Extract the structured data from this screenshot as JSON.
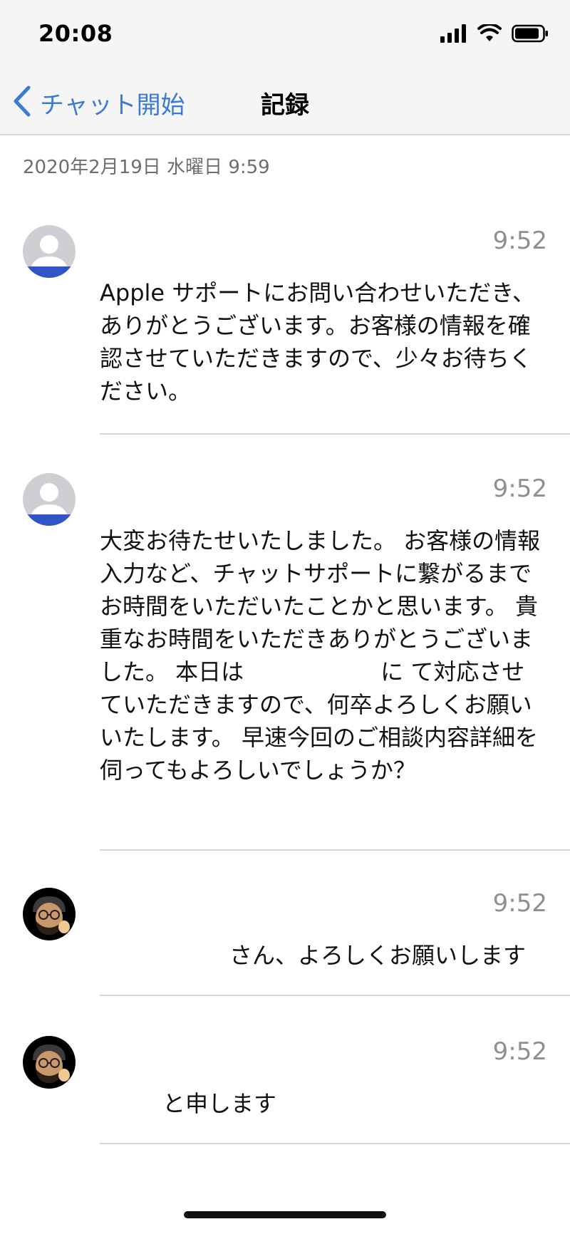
{
  "status_bar": {
    "time": "20:08",
    "icons": [
      "signal-icon",
      "wifi-icon",
      "battery-icon"
    ]
  },
  "nav": {
    "back_label": "チャット開始",
    "title": "記録"
  },
  "session_date": "2020年2月19日 水曜日 9:59",
  "colors": {
    "accent": "#3a7bd5",
    "bar_bg": "#f5f5f6",
    "secondary_text": "#8e8e93",
    "divider": "#d6d6d9"
  },
  "messages": [
    {
      "time": "9:52",
      "avatar": "advisor-avatar",
      "text": "Apple サポートにお問い合わせいただき、ありがとうございます。お客様の情報を確認させていただきますので、少々お待ちください。"
    },
    {
      "time": "9:52",
      "avatar": "advisor-avatar",
      "text": "大変お待たせいたしました。 お客様の情報入力など、チャットサポートに繋がるまでお時間をいただいたことかと思います。 貴重なお時間をいただきありがとうございました。 本日は　　　　　　に て対応させていただきますので、何卒よろしくお願いいたします。 早速今回のご相談内容詳細を伺ってもよろしいでしょうか？"
    },
    {
      "time": "9:52",
      "avatar": "user-avatar",
      "text": "さん、よろしくお願いします"
    },
    {
      "time": "9:52",
      "avatar": "user-avatar",
      "text": "と申します"
    }
  ]
}
